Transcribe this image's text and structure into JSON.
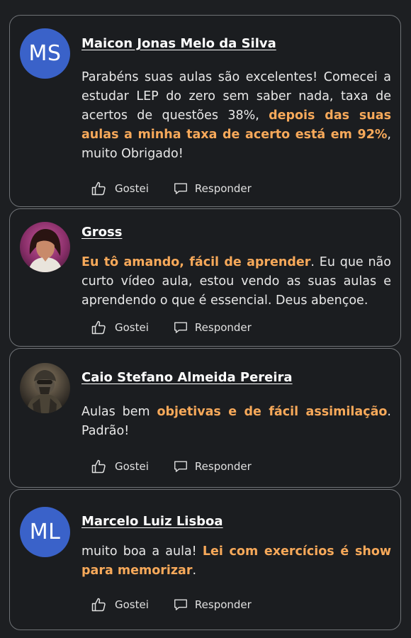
{
  "colors": {
    "highlight": "#f7a95a",
    "avatar_initials_bg": "#3a62c9",
    "card_border": "#6f7276",
    "background": "#1d1f22"
  },
  "actions": {
    "like_label": "Gostei",
    "reply_label": "Responder",
    "like_icon": "thumbs-up-icon",
    "reply_icon": "speech-bubble-icon"
  },
  "comments": [
    {
      "avatar_initials": "MS",
      "name": "Maicon Jonas Melo da Silva",
      "text_1": "Parabéns suas aulas são excelentes! Comecei a estudar LEP do zero sem saber nada, taxa de acertos de questões 38%, ",
      "highlight_1": "depois das suas aulas a minha taxa de acerto está em 92%",
      "text_2": ", muito Obrigado!"
    },
    {
      "avatar_photo": "woman-portrait-photo",
      "name": "Gross",
      "highlight_1": "Eu tô amando, fácil de aprender",
      "text_1": ". Eu que não curto vídeo aula, estou vendo as suas aulas e aprendendo o que é essencial. Deus abençoe."
    },
    {
      "avatar_photo": "soldier-portrait-photo",
      "name": "Caio Stefano Almeida Pereira",
      "text_1": "Aulas bem ",
      "highlight_1": "objetivas e de fácil assimilação",
      "text_2": ". Padrão!"
    },
    {
      "avatar_initials": "ML",
      "name": "Marcelo Luiz Lisboa",
      "text_1": "muito boa a aula! ",
      "highlight_1": "Lei com exercícios é show para memorizar",
      "text_2": "."
    }
  ]
}
